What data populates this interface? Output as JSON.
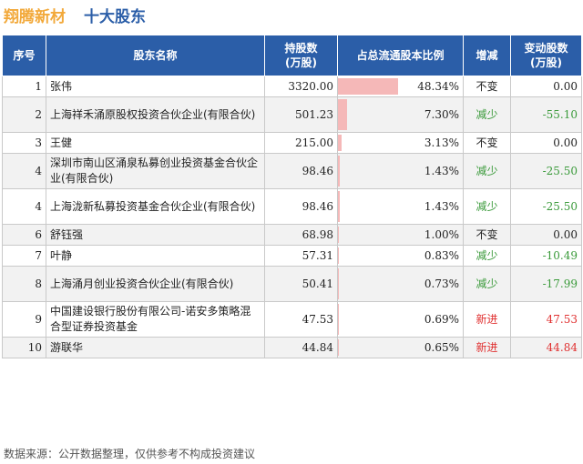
{
  "header": {
    "company": "翔腾新材",
    "subtitle": "十大股东"
  },
  "columns": [
    "序号",
    "股东名称",
    "持股数\n(万股)",
    "占总流通股本比例",
    "增减",
    "变动股数\n(万股)"
  ],
  "rows": [
    {
      "rank": "1",
      "name": "张伟",
      "shares": "3320.00",
      "ratio": "48.34%",
      "ratio_value": 48.34,
      "change": "不变",
      "delta": "0.00",
      "status": "same"
    },
    {
      "rank": "2",
      "name": "上海祥禾涌原股权投资合伙企业(有限合伙)",
      "shares": "501.23",
      "ratio": "7.30%",
      "ratio_value": 7.3,
      "change": "减少",
      "delta": "-55.10",
      "status": "down"
    },
    {
      "rank": "3",
      "name": "王健",
      "shares": "215.00",
      "ratio": "3.13%",
      "ratio_value": 3.13,
      "change": "不变",
      "delta": "0.00",
      "status": "same"
    },
    {
      "rank": "4",
      "name": "深圳市南山区涌泉私募创业投资基金合伙企业(有限合伙)",
      "shares": "98.46",
      "ratio": "1.43%",
      "ratio_value": 1.43,
      "change": "减少",
      "delta": "-25.50",
      "status": "down"
    },
    {
      "rank": "4",
      "name": "上海泷新私募投资基金合伙企业(有限合伙)",
      "shares": "98.46",
      "ratio": "1.43%",
      "ratio_value": 1.43,
      "change": "减少",
      "delta": "-25.50",
      "status": "down"
    },
    {
      "rank": "6",
      "name": "舒钰强",
      "shares": "68.98",
      "ratio": "1.00%",
      "ratio_value": 1.0,
      "change": "不变",
      "delta": "0.00",
      "status": "same"
    },
    {
      "rank": "7",
      "name": "叶静",
      "shares": "57.31",
      "ratio": "0.83%",
      "ratio_value": 0.83,
      "change": "减少",
      "delta": "-10.49",
      "status": "down"
    },
    {
      "rank": "8",
      "name": "上海涌月创业投资合伙企业(有限合伙)",
      "shares": "50.41",
      "ratio": "0.73%",
      "ratio_value": 0.73,
      "change": "减少",
      "delta": "-17.99",
      "status": "down"
    },
    {
      "rank": "9",
      "name": "中国建设银行股份有限公司-诺安多策略混合型证券投资基金",
      "shares": "47.53",
      "ratio": "0.69%",
      "ratio_value": 0.69,
      "change": "新进",
      "delta": "47.53",
      "status": "new"
    },
    {
      "rank": "10",
      "name": "游联华",
      "shares": "44.84",
      "ratio": "0.65%",
      "ratio_value": 0.65,
      "change": "新进",
      "delta": "44.84",
      "status": "new"
    }
  ],
  "colors": {
    "header_bg": "#2b5ea8",
    "title_company": "#f2a93b",
    "bar": "#f5b8b8",
    "down": "#3a9a3a",
    "new": "#e03030"
  },
  "footer": "数据来源：公开数据整理，仅供参考不构成投资建议"
}
